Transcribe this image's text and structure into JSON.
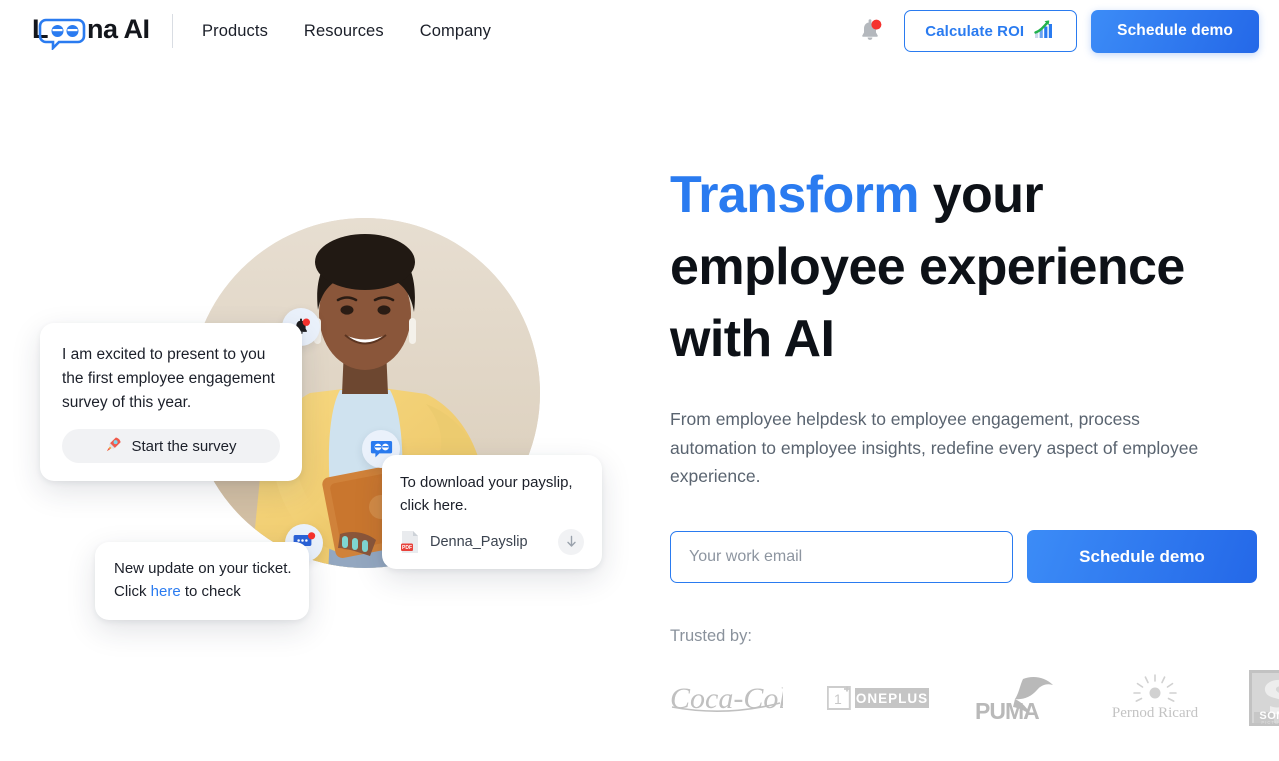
{
  "brand": {
    "name": "Leena AI",
    "accent_color": "#2a7bf0",
    "logo_text_left": "L",
    "logo_bubble_text": "ee",
    "logo_text_right": "na AI"
  },
  "nav": {
    "links": [
      {
        "label": "Products"
      },
      {
        "label": "Resources"
      },
      {
        "label": "Company"
      }
    ],
    "notification_icon": "bell-icon",
    "notification_dot_color": "#f5322e",
    "roi_button": {
      "label": "Calculate ROI",
      "icon": "growth-chart-icon"
    },
    "demo_button": {
      "label": "Schedule demo"
    }
  },
  "hero": {
    "headline_accent": "Transform",
    "headline_rest": " your employee experience with AI",
    "subhead": "From employee helpdesk to employee engagement, process automation to employee insights, redefine every aspect of employee experience.",
    "email": {
      "placeholder": "Your work email",
      "value": ""
    },
    "submit_button": {
      "label": "Schedule demo"
    },
    "trusted_label": "Trusted by:",
    "clients": [
      {
        "name": "Coca-Cola",
        "logo": "coca-cola-logo"
      },
      {
        "name": "ONEPLUS",
        "logo": "oneplus-logo"
      },
      {
        "name": "PUMA",
        "logo": "puma-logo"
      },
      {
        "name": "Pernod Ricard",
        "logo": "pernod-ricard-logo"
      },
      {
        "name": "SONY PICTURES NETWORKS",
        "logo": "sony-pictures-logo"
      }
    ]
  },
  "illustration": {
    "survey_card": {
      "text": "I am excited to present to you the first employee engagement survey of this year.",
      "button_label": "Start the survey",
      "button_icon": "rocket-icon"
    },
    "payslip_card": {
      "text": "To download your payslip, click here.",
      "file_name": "Denna_Payslip",
      "file_icon": "pdf-file-icon",
      "download_icon": "download-arrow-icon"
    },
    "ticket_card": {
      "text_before": "New update on your ticket. Click ",
      "link_text": "here",
      "text_after": " to check"
    },
    "badges": [
      {
        "icon": "bell-notification-icon"
      },
      {
        "icon": "leena-chat-bubble-icon"
      },
      {
        "icon": "chat-message-notification-icon"
      }
    ]
  }
}
